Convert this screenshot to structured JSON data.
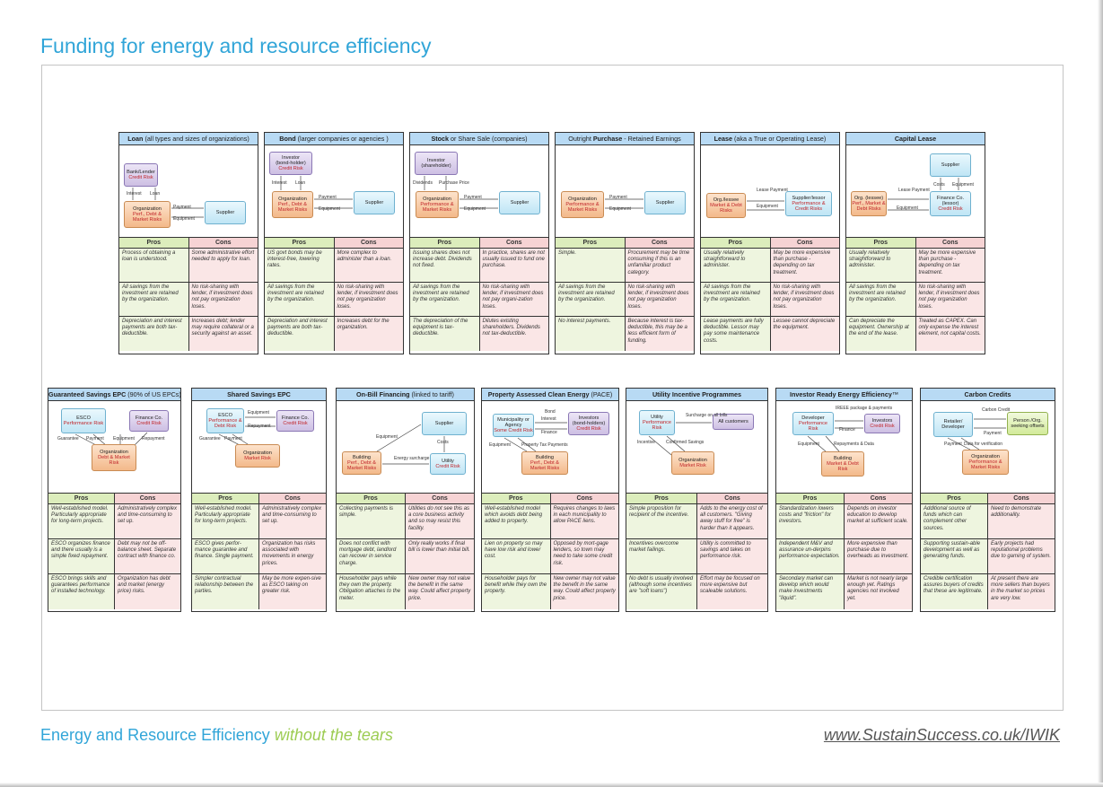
{
  "page_title": "Funding for energy and resource efficiency",
  "footer": {
    "left": "Energy and Resource Efficiency",
    "tagline": "without the tears",
    "url": "www.SustainSuccess.co.uk/IWIK"
  },
  "pros_label": "Pros",
  "cons_label": "Cons",
  "row1": [
    {
      "title_b": "Loan",
      "title_r": " (all types and sizes of organizations)",
      "rows": [
        [
          "Process of obtaining a loan is understood.",
          "Some administrative effort needed to apply for loan."
        ],
        [
          "All savings from the investment are retained by the organization.",
          "No risk-sharing with lender, if investment does not pay organization loses."
        ],
        [
          "Depreciation and interest payments are both tax-deductible.",
          "Increases debt; lender may require collateral or a security against an asset."
        ]
      ]
    },
    {
      "title_b": "Bond",
      "title_r": " (larger companies or agencies )",
      "rows": [
        [
          "US govt bonds may be interest-free, lowering rates.",
          "More complex to administer than a loan."
        ],
        [
          "All savings from the investment are retained by the organization.",
          "No risk-sharing with lender, if investment does not pay organization loses."
        ],
        [
          "Depreciation and interest payments are both tax-deductible.",
          "Increases debt for the organization."
        ]
      ]
    },
    {
      "title_b": "Stock",
      "title_r": " or Share Sale (companies)",
      "rows": [
        [
          "Issuing shares does not increase debt. Dividends not fixed.",
          "In practice, shares are not usually issued to fund one purchase."
        ],
        [
          "All savings from the investment are retained by the organization.",
          "No risk-sharing with lender, if investment does not pay organi-zation loses."
        ],
        [
          "The depreciation of the equipment is tax-deductible.",
          "Dilutes existing shareholders. Dividends not tax-deductible."
        ]
      ]
    },
    {
      "title_pre": "Outright ",
      "title_b": "Purchase",
      "title_r": " - Retained Earnings",
      "rows": [
        [
          "Simple.",
          "Procurement may be time consuming if this is an unfamiliar product category."
        ],
        [
          "All savings from the investment are retained by the organization.",
          "No risk-sharing with lender, if investment does not pay organization loses."
        ],
        [
          "No interest payments.",
          "Because interest is tax-deductible, this may be a less efficient form of funding."
        ]
      ]
    },
    {
      "title_b": "Lease",
      "title_r": " (aka a True or Operating Lease)",
      "rows": [
        [
          "Usually relatively straightforward to administer.",
          "May be more expensive than purchase - depending on tax treatment."
        ],
        [
          "All savings from the investment are retained by the organization.",
          "No risk-sharing with lender, if investment does not pay organization loses."
        ],
        [
          "Lease payments are fully deductible. Lessor may pay some maintenance costs.",
          "Lessee cannot depreciate the equipment."
        ]
      ]
    },
    {
      "title_b": "Capital Lease",
      "title_r": "",
      "rows": [
        [
          "Usually relatively straightforward to administer.",
          "May be more expensive than purchase - depending on tax treatment."
        ],
        [
          "All savings from the investment are retained by the organization.",
          "No risk-sharing with lender, if investment does not pay organization loses."
        ],
        [
          "Can depreciate the equipment. Ownership at the end of the lease.",
          "Treated as CAPEX. Can only expense the interest element, not capital costs."
        ]
      ]
    }
  ],
  "row2": [
    {
      "title_b": "Guaranteed Savings EPC",
      "title_r": " (90% of US EPCs)",
      "rows": [
        [
          "Well-established model. Particularly appropriate for long-term projects.",
          "Administratively complex and time-consuming to set up."
        ],
        [
          "ESCO organizes finance and there usually is a simple fixed repayment.",
          "Debt may not be off-balance sheet. Separate contract with finance co."
        ],
        [
          "ESCO brings skills and guarantees performance of installed technology.",
          "Organization has debt and market (energy price) risks."
        ]
      ]
    },
    {
      "title_b": "Shared Savings EPC",
      "title_r": "",
      "rows": [
        [
          "Well-established model. Particularly appropriate for long-term projects.",
          "Administratively complex and time-consuming to set up."
        ],
        [
          "ESCO gives perfor-mance guarantee and finance. Single payment.",
          "Organization has risks associated with movements in energy prices."
        ],
        [
          "Simpler contractual relationship between the parties.",
          "May be more expen-sive as ESCO taking on greater risk."
        ]
      ]
    },
    {
      "title_b": "On-Bill Financing",
      "title_r": " (linked to tariff)",
      "rows": [
        [
          "Collecting payments is simple.",
          "Utilities do not see this as a core business activity and so may resist this facility."
        ],
        [
          "Does not conflict with mortgage debt, landlord can recover in service charge.",
          "Only really works if final bill is lower than initial bill."
        ],
        [
          "Householder pays while they own the property. Obligation attaches to the meter.",
          "New owner may not value the benefit in the same way. Could affect property price."
        ]
      ]
    },
    {
      "title_b": "Property Assessed Clean Energy",
      "title_r": " (PACE)",
      "rows": [
        [
          "Well-established model which avoids debt being added to property.",
          "Requires changes to laws in each municipality to allow PACE liens."
        ],
        [
          "Lien on property so may have low risk and lower cost.",
          "Opposed by mort-gage lenders, so town may need to take some credit risk."
        ],
        [
          "Householder pays for benefit while they own the property.",
          "New owner may not value the benefit in the same way. Could affect property price."
        ]
      ]
    },
    {
      "title_b": "Utility Incentive Programmes",
      "title_r": "",
      "rows": [
        [
          "Simple proposition for recipient of the incentive.",
          "Adds to the energy cost of all customers. \"Giving away stuff for free\" is harder than it appears."
        ],
        [
          "Incentives overcome market failings.",
          "Utility is committed to savings and takes on performance risk."
        ],
        [
          "No debt is usually involved (although some incentives are \"soft loans\")",
          "Effort may be focused on more expensive but scaleable solutions."
        ]
      ]
    },
    {
      "title_b": "Investor Ready Energy Efficiency",
      "title_r": "™",
      "rows": [
        [
          "Standardization lowers costs and \"friction\" for investors.",
          "Depends on investor education to develop market at sufficient scale."
        ],
        [
          "Independent M&V and assurance un-derpins performance expectation.",
          "More expensive than purchase due to overheads as investment."
        ],
        [
          "Secondary market can develop which would make investments \"liquid\".",
          "Market is not nearly large enough yet. Ratings agencies not involved yet."
        ]
      ]
    },
    {
      "title_b": "Carbon Credits",
      "title_r": "",
      "rows": [
        [
          "Additional source of funds which can complement other sources.",
          "Need to demonstrate additionality."
        ],
        [
          "Supporting sustain-able development as well as generating funds.",
          "Early projects had reputational problems due to gaming of system."
        ],
        [
          "Credible certification assures buyers of credits that these are legitimate.",
          "At present there are more sellers than buyers in the market so prices are very low."
        ]
      ]
    }
  ],
  "diagrams": {
    "bank": "Bank/Lender",
    "credit_risk": "Credit Risk",
    "organization": "Organization",
    "pdm_risks": "Perf., Debt & Market Risks",
    "supplier": "Supplier",
    "interest": "Interest",
    "loan": "Loan",
    "payment": "Payment",
    "equipment": "Equipment",
    "investor_bh": "Investor",
    "bondholder": "(bond-holder)",
    "investor_sh": "Investor",
    "shareholder": "(shareholder)",
    "dividends": "Dividends",
    "purchase_price": "Purchase Price",
    "perf_market": "Performance & Market Risks",
    "org_lessee": "Org./lessee",
    "md_risks": "Market & Debt Risks",
    "lease_payment": "Lease Payment",
    "supplier_lessor": "Supplier/lessor",
    "perf_credit": "Performance & Credit Risks",
    "org_lessee2": "Org. (lessee)",
    "pmd_risks": "Perf., Market & Debt Risks",
    "finance_co": "Finance Co.",
    "lessor": "(lessor)",
    "costs": "Costs",
    "esco": "ESCO",
    "perf_risk": "Performance Risk",
    "guarantee": "Guarantee",
    "repayment": "Repayment",
    "debt_market": "Debt & Market Risk",
    "esco_pdr": "Performance & Debt Risk",
    "market_risk": "Market Risk",
    "building": "Building",
    "energy_surcharge": "Energy surcharge",
    "utility": "Utility",
    "municipality": "Municipality or Agency",
    "some_credit": "Some Credit Risk",
    "bond": "Bond",
    "investors_bh": "Investors",
    "bondholders": "(bond-holders)",
    "finance": "Finance",
    "property_tax": "Property Tax Payments",
    "surcharge_bills": "Surcharge on all bills",
    "all_customers": "All customers",
    "incentive": "Incentive",
    "confirmed_savings": "Confirmed Savings",
    "developer": "Developer",
    "ireee": "IREEE package & payments",
    "investors": "Investors",
    "repayments_data": "Repayments & Data",
    "market_debt": "Market & Debt Risk",
    "retailer": "Retailer/ Developer",
    "carbon_credit": "Carbon Credit",
    "person_org": "Person /Org. seeking offsets",
    "data_verification": "Data for verification"
  }
}
